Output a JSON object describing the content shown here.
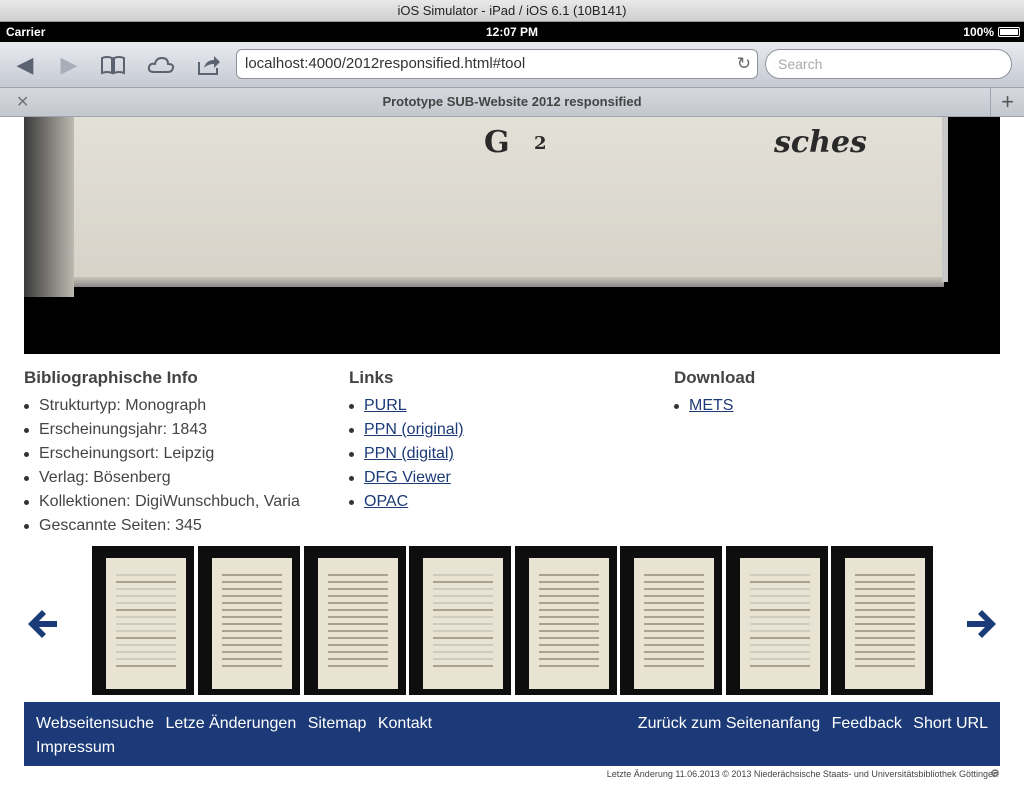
{
  "simulator": {
    "title": "iOS Simulator - iPad / iOS 6.1 (10B141)"
  },
  "statusbar": {
    "carrier": "Carrier",
    "time": "12:07 PM",
    "battery": "100%"
  },
  "browser": {
    "url": "localhost:4000/2012responsified.html#tool",
    "search_placeholder": "Search",
    "tab_title": "Prototype SUB-Website 2012 responsified",
    "icons": [
      "back-icon",
      "forward-icon",
      "bookmarks-icon",
      "icloud-icon",
      "share-icon",
      "reload-icon",
      "close-icon",
      "plus-icon"
    ]
  },
  "viewer": {
    "sig": "G",
    "num": "2",
    "word": "sches"
  },
  "bib": {
    "title": "Bibliographische Info",
    "items": [
      "Strukturtyp: Monograph",
      "Erscheinungsjahr: 1843",
      "Erscheinungsort: Leipzig",
      "Verlag: Bösenberg",
      "Kollektionen: DigiWunschbuch, Varia",
      "Gescannte Seiten: 345"
    ]
  },
  "links": {
    "title": "Links",
    "items": [
      "PURL",
      "PPN (original)",
      "PPN (digital)",
      "DFG Viewer",
      "OPAC"
    ]
  },
  "download": {
    "title": "Download",
    "items": [
      "METS"
    ]
  },
  "carousel": {
    "prev_icon": "arrow-left-icon",
    "next_icon": "arrow-right-icon",
    "count": 8
  },
  "footer": {
    "left": [
      "Webseitensuche",
      "Letze Änderungen",
      "Sitemap",
      "Kontakt",
      "Impressum"
    ],
    "right": [
      "Zurück zum Seitenanfang",
      "Feedback",
      "Short URL"
    ],
    "bottom": "Letzte Änderung 11.06.2013 © 2013 Niederächsische Staats- und Universitätsbibliothek Göttingen"
  },
  "colors": {
    "accent": "#1c3a78"
  }
}
